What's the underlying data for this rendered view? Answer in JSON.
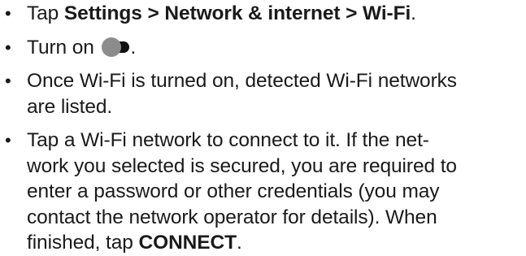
{
  "steps": [
    {
      "prefix": "Tap ",
      "bold": "Settings > Network & internet > Wi-Fi",
      "suffix": "."
    },
    {
      "prefix": "Turn on ",
      "suffix": ".",
      "icon": "toggle-switch-icon"
    },
    {
      "lines": [
        "Once Wi-Fi is turned on, detected Wi-Fi networks",
        "are listed."
      ]
    },
    {
      "lines": [
        "Tap a Wi-Fi network to connect to it. If the net-",
        "work you selected is secured, you are required to",
        "enter a password or other credentials (you may",
        "contact the network operator for details). When"
      ],
      "last_prefix": "finished, tap ",
      "last_bold": "CONNECT",
      "last_suffix": "."
    }
  ],
  "bullet": "•",
  "colors": {
    "text": "#1a1a1a",
    "toggle_knob": "#8c8c8c",
    "toggle_track": "#111111"
  }
}
